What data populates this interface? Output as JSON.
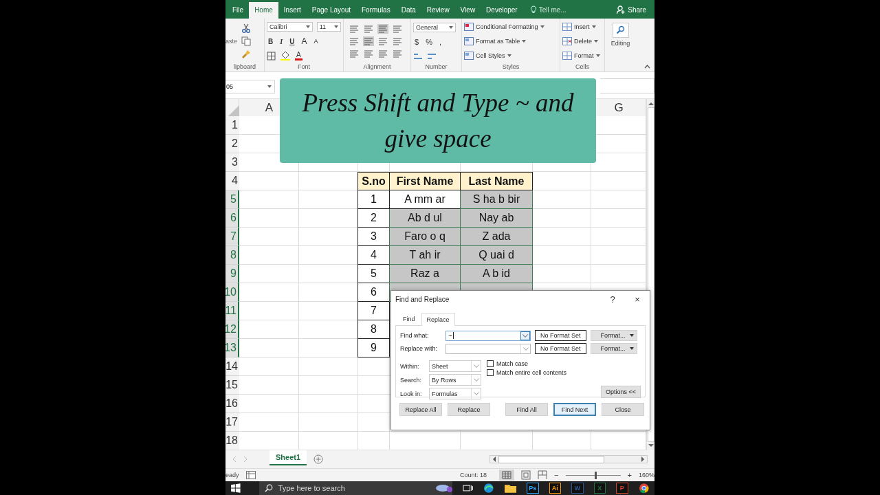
{
  "ribbon": {
    "tabs": [
      {
        "label": "File",
        "selected": false
      },
      {
        "label": "Home",
        "selected": true
      },
      {
        "label": "Insert",
        "selected": false
      },
      {
        "label": "Page Layout",
        "selected": false
      },
      {
        "label": "Formulas",
        "selected": false
      },
      {
        "label": "Data",
        "selected": false
      },
      {
        "label": "Review",
        "selected": false
      },
      {
        "label": "View",
        "selected": false
      },
      {
        "label": "Developer",
        "selected": false
      }
    ],
    "tell_me": "Tell me...",
    "share": "Share",
    "clipboard": {
      "paste": "aste",
      "label": "lipboard"
    },
    "font": {
      "name": "Calibri",
      "size": "11",
      "buttons": [
        "B",
        "I",
        "U"
      ],
      "grow": "A",
      "shrink": "A",
      "color_letter": "A",
      "label": "Font"
    },
    "alignment": {
      "label": "Alignment"
    },
    "number": {
      "format": "General",
      "symbols": [
        "$",
        "%",
        ","
      ],
      "label": "Number"
    },
    "styles": {
      "items": [
        "Conditional Formatting",
        "Format as Table",
        "Cell Styles"
      ],
      "label": "Styles"
    },
    "cells": {
      "items": [
        "Insert",
        "Delete",
        "Format"
      ],
      "label": "Cells"
    },
    "editing": {
      "label": "Editing"
    }
  },
  "formula_bar": {
    "name_box": "05"
  },
  "banner": {
    "text": "Press Shift and Type ~ and give space"
  },
  "sheet": {
    "column_headers": [
      "A",
      "G"
    ],
    "row_headers": [
      {
        "label": "1",
        "selected": false
      },
      {
        "label": "2",
        "selected": false
      },
      {
        "label": "3",
        "selected": false
      },
      {
        "label": "4",
        "selected": false
      },
      {
        "label": "5",
        "selected": true
      },
      {
        "label": "6",
        "selected": true
      },
      {
        "label": "7",
        "selected": true
      },
      {
        "label": "8",
        "selected": true
      },
      {
        "label": "9",
        "selected": true
      },
      {
        "label": "10",
        "selected": true
      },
      {
        "label": "11",
        "selected": true
      },
      {
        "label": "12",
        "selected": true
      },
      {
        "label": "13",
        "selected": true
      },
      {
        "label": "14",
        "selected": false
      },
      {
        "label": "15",
        "selected": false
      },
      {
        "label": "16",
        "selected": false
      },
      {
        "label": "17",
        "selected": false
      },
      {
        "label": "18",
        "selected": false
      }
    ],
    "table": {
      "headers": [
        "S.no",
        "First Name",
        "Last Name"
      ],
      "rows": [
        {
          "sno": "1",
          "names": [
            {
              "text": "A mm ar",
              "selected": false
            },
            {
              "text": "S ha b bir",
              "selected": true
            }
          ]
        },
        {
          "sno": "2",
          "names": [
            {
              "text": "Ab d ul",
              "selected": true
            },
            {
              "text": "Nay ab",
              "selected": true
            }
          ]
        },
        {
          "sno": "3",
          "names": [
            {
              "text": "Faro o q",
              "selected": true
            },
            {
              "text": "Z ada",
              "selected": true
            }
          ]
        },
        {
          "sno": "4",
          "names": [
            {
              "text": "T ah ir",
              "selected": true
            },
            {
              "text": "Q uai d",
              "selected": true
            }
          ]
        },
        {
          "sno": "5",
          "names": [
            {
              "text": "Raz a",
              "selected": true
            },
            {
              "text": "A b id",
              "selected": true
            }
          ]
        },
        {
          "sno": "6",
          "names": [
            {
              "selected": true
            },
            {
              "selected": true
            }
          ]
        },
        {
          "sno": "7"
        },
        {
          "sno": "8"
        },
        {
          "sno": "9"
        }
      ]
    },
    "sheet_tabs": [
      {
        "label": "Sheet1",
        "selected": true
      }
    ]
  },
  "dialog": {
    "title": "Find and Replace",
    "help": "?",
    "close": "×",
    "tabs": [
      {
        "label": "Find",
        "selected": false
      },
      {
        "label": "Replace",
        "selected": true
      }
    ],
    "find_what": {
      "label": "Find what:",
      "value": "~"
    },
    "replace_with": {
      "label": "Replace with:"
    },
    "format_status": [
      "No Format Set",
      "No Format Set"
    ],
    "format_buttons": [
      "Format...",
      "Format..."
    ],
    "options": [
      {
        "label": "Within:",
        "value": "Sheet"
      },
      {
        "label": "Search:",
        "value": "By Rows"
      },
      {
        "label": "Look in:",
        "value": "Formulas"
      }
    ],
    "checkboxes": [
      {
        "label": "Match case",
        "checked": false
      },
      {
        "label": "Match entire cell contents",
        "checked": false
      }
    ],
    "options_button": "Options <<",
    "buttons": [
      {
        "label": "Replace All",
        "default": false
      },
      {
        "label": "Replace",
        "default": false
      },
      {
        "label": "Find All",
        "default": false
      },
      {
        "label": "Find Next",
        "default": true
      },
      {
        "label": "Close",
        "default": false
      }
    ]
  },
  "status_bar": {
    "mode": "eady",
    "count": "Count: 18",
    "zoom": {
      "zoom_out": "−",
      "zoom_in": "+",
      "level": 0.55,
      "reading": "160%"
    }
  },
  "taskbar": {
    "search_placeholder": "Type here to search",
    "apps": [
      {
        "label": "Ps",
        "color": "#31a8ff"
      },
      {
        "label": "Ai",
        "color": "#ff9a00"
      },
      {
        "label": "W",
        "color": "#2b579a"
      },
      {
        "label": "X",
        "color": "#217346"
      },
      {
        "label": "P",
        "color": "#d24726"
      }
    ]
  }
}
